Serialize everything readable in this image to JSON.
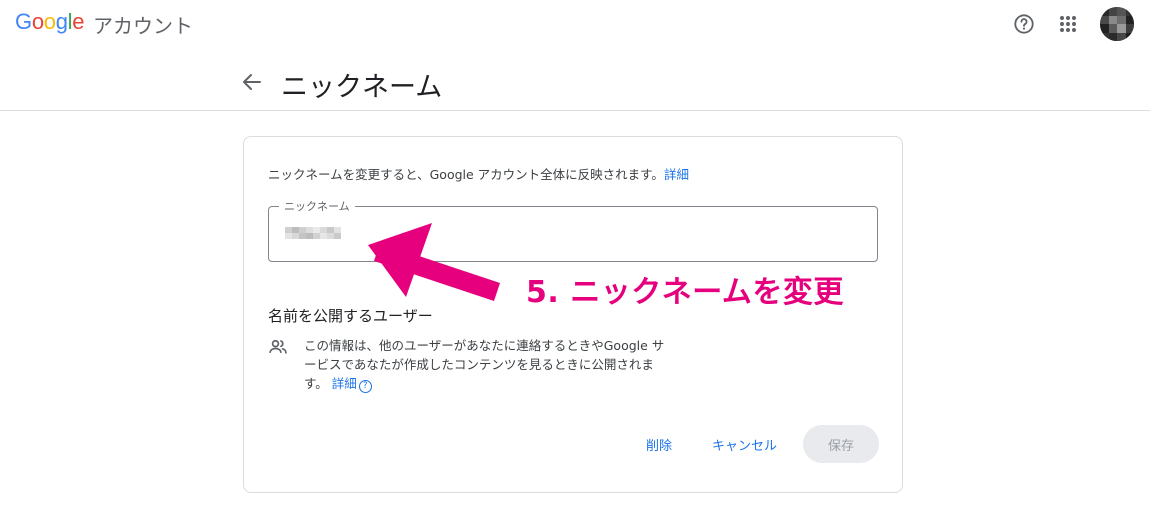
{
  "app": {
    "logo_text": "Google",
    "product_name": "アカウント",
    "logo_colors": [
      "#4285F4",
      "#EA4335",
      "#FBBC05",
      "#4285F4",
      "#34A853",
      "#EA4335"
    ]
  },
  "topbar": {
    "icons": [
      "help-icon",
      "apps-grid-icon",
      "avatar"
    ]
  },
  "header": {
    "title": "ニックネーム"
  },
  "card": {
    "description": "ニックネームを変更すると、Google アカウント全体に反映されます。",
    "description_link": "詳細",
    "field": {
      "label": "ニックネーム",
      "value_hidden": "pixelated"
    },
    "section_title": "名前を公開するユーザー",
    "info_text": "この情報は、他のユーザーがあなたに連絡するときやGoogle サービスであなたが作成したコンテンツを見るときに公開されます。",
    "info_link": "詳細",
    "buttons": {
      "delete": "削除",
      "cancel": "キャンセル",
      "save": "保存"
    }
  },
  "annotation": {
    "text": "5. ニックネームを変更",
    "color": "#e6007e"
  },
  "colors": {
    "link": "#1a73e8",
    "border": "#dadce0",
    "save_disabled_bg": "#e8eaed"
  }
}
